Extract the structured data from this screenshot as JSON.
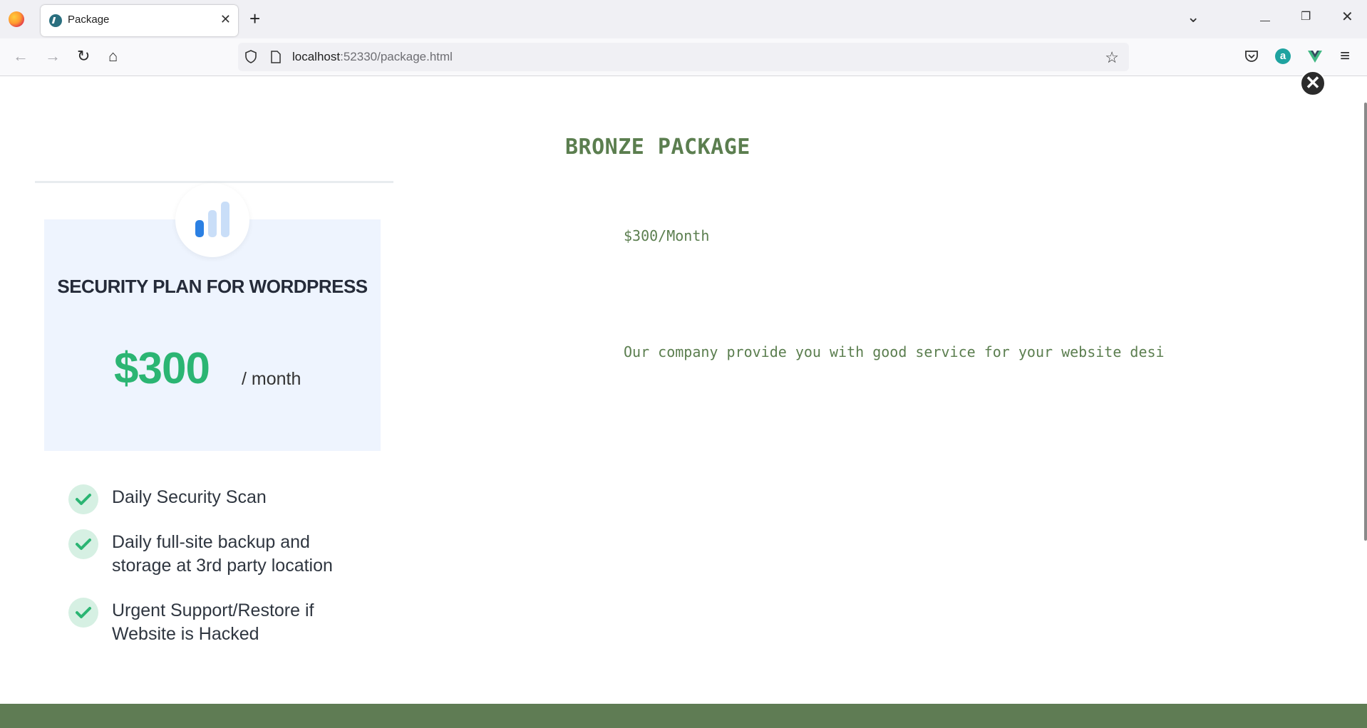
{
  "browser": {
    "tab_title": "Package",
    "tab_close": "✕",
    "new_tab": "+",
    "url_host": "localhost",
    "url_rest": ":52330/package.html",
    "controls": {
      "list": "⌄",
      "minimize": "—",
      "restore": "❐",
      "close": "✕"
    },
    "nav": {
      "back": "←",
      "forward": "→",
      "reload": "↻",
      "home": "⌂",
      "menu": "≡"
    }
  },
  "page": {
    "close_symbol": "✕",
    "plan": {
      "title": "SECURITY PLAN FOR WORDPRESS",
      "price": "$300",
      "period": "/ month",
      "features": [
        "Daily Security Scan",
        "Daily full-site backup and storage at 3rd party location",
        "Urgent Support/Restore if Website is Hacked"
      ]
    },
    "package": {
      "title": "BRONZE PACKAGE",
      "price": "$300/Month",
      "description": "Our company provide you with good service for your website design"
    }
  },
  "colors": {
    "accent_green": "#2bb573",
    "package_text": "#5b7e4f",
    "footer": "#5f7c54",
    "plan_bg": "#eef4fe"
  }
}
